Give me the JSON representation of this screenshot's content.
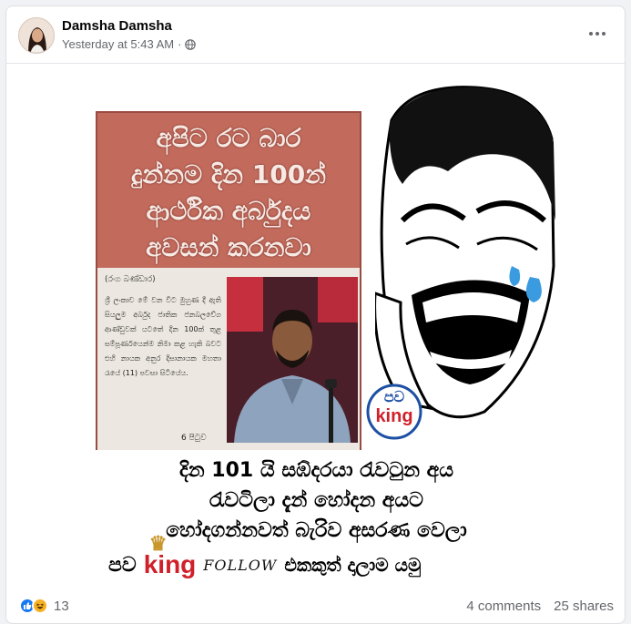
{
  "post": {
    "author": "Damsha Damsha",
    "timestamp": "Yesterday at 5:43 AM",
    "separator": "·",
    "privacy_icon": "globe-icon",
    "more_icon": "more-options-icon"
  },
  "image": {
    "clipping_headline_lines": [
      "අපිට රට බාර",
      "දුන්නම දින 100න්",
      "ආර්ථික අර්බුදය",
      "අවසන් කරනවා"
    ],
    "clipping_byline": "(රංග බණ්ඩාර)",
    "clipping_body": "ශ්‍රී ලංකාව මේ වන විට මුහුණ දී ඇති සියලුම අර්බුද ජාතික ජනබලවේග ආණ්ඩුවක් යටතේ දින 100ක් තුළ සම්පූර්ණයෙන්ම නිමා කළ හැකි බවට එහි නායක අනුර දිසානායක මහතා රැයේ (11) පවසා සිටියේය.",
    "clipping_page": "6 පිටුව",
    "logo_top": "පව",
    "logo_bottom": "king",
    "caption_lines": [
      "දින 101 යි සඹ්දරයා  රැවටුන අය",
      "රැවටිලා දැන් හෝදන අයට",
      "හෝදගන්නවත් බැරිව අසරණ වෙලා"
    ],
    "brand_si": "පව",
    "brand_king": "king",
    "brand_follow": "FOLLOW",
    "brand_tail": "එකකුත් දාලාම යමු"
  },
  "footer": {
    "reaction_icons": [
      "like-icon",
      "haha-icon"
    ],
    "reaction_count": "13",
    "comments": "4 comments",
    "shares": "25 shares"
  },
  "colors": {
    "clipping_red": "#c26a5c",
    "king_red": "#d0202a",
    "like_blue": "#1877f2",
    "haha_yellow": "#f7b125",
    "tear_blue": "#3a9be0"
  }
}
